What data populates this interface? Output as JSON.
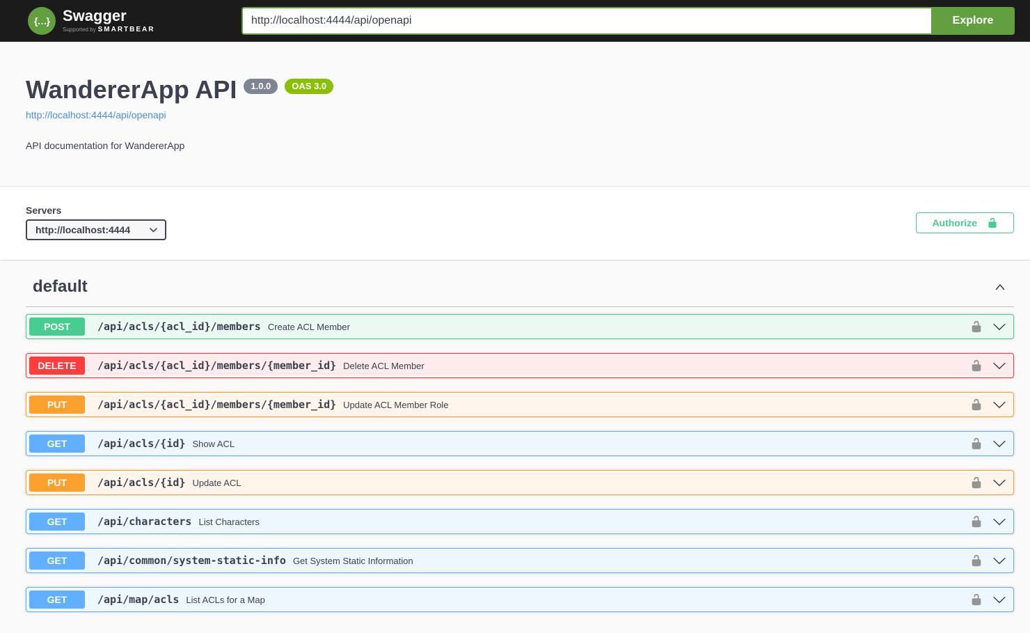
{
  "topbar": {
    "logo_glyph": "{…}",
    "logo_text": "Swagger",
    "logo_tagline_prefix": "Supported by",
    "logo_tagline_brand": "SMARTBEAR",
    "url_value": "http://localhost:4444/api/openapi",
    "explore_label": "Explore"
  },
  "info": {
    "title": "WandererApp API",
    "version_badge": "1.0.0",
    "oas_badge": "OAS 3.0",
    "spec_link": "http://localhost:4444/api/openapi",
    "description": "API documentation for WandererApp"
  },
  "scheme": {
    "servers_label": "Servers",
    "server_selected": "http://localhost:4444",
    "authorize_label": "Authorize"
  },
  "section": {
    "title": "default"
  },
  "operations": [
    {
      "method": "POST",
      "path": "/api/acls/{acl_id}/members",
      "summary": "Create ACL Member"
    },
    {
      "method": "DELETE",
      "path": "/api/acls/{acl_id}/members/{member_id}",
      "summary": "Delete ACL Member"
    },
    {
      "method": "PUT",
      "path": "/api/acls/{acl_id}/members/{member_id}",
      "summary": "Update ACL Member Role"
    },
    {
      "method": "GET",
      "path": "/api/acls/{id}",
      "summary": "Show ACL"
    },
    {
      "method": "PUT",
      "path": "/api/acls/{id}",
      "summary": "Update ACL"
    },
    {
      "method": "GET",
      "path": "/api/characters",
      "summary": "List Characters"
    },
    {
      "method": "GET",
      "path": "/api/common/system-static-info",
      "summary": "Get System Static Information"
    },
    {
      "method": "GET",
      "path": "/api/map/acls",
      "summary": "List ACLs for a Map"
    }
  ],
  "icons": {
    "logo": "swagger-braces",
    "authorize_lock": "unlocked-padlock",
    "operation_lock": "unlocked-padlock",
    "section_collapse": "chevron-up",
    "operation_expand": "chevron-down",
    "server_select": "chevron-down"
  },
  "colors": {
    "topbar_bg": "#1b1b1b",
    "brand_green": "#62a03f",
    "link_blue": "#4990e2",
    "authorize_green": "#49cc90",
    "version_badge_bg": "#7d8492",
    "oas_badge_bg": "#89bf04",
    "lock_gray": "#949494",
    "get": "#61affe",
    "get_bg": "#eff7fe",
    "post": "#49cc90",
    "post_bg": "#ecf9f3",
    "put": "#fca130",
    "put_bg": "#fff5ea",
    "delete": "#f93e3e",
    "delete_bg": "#feecec"
  }
}
